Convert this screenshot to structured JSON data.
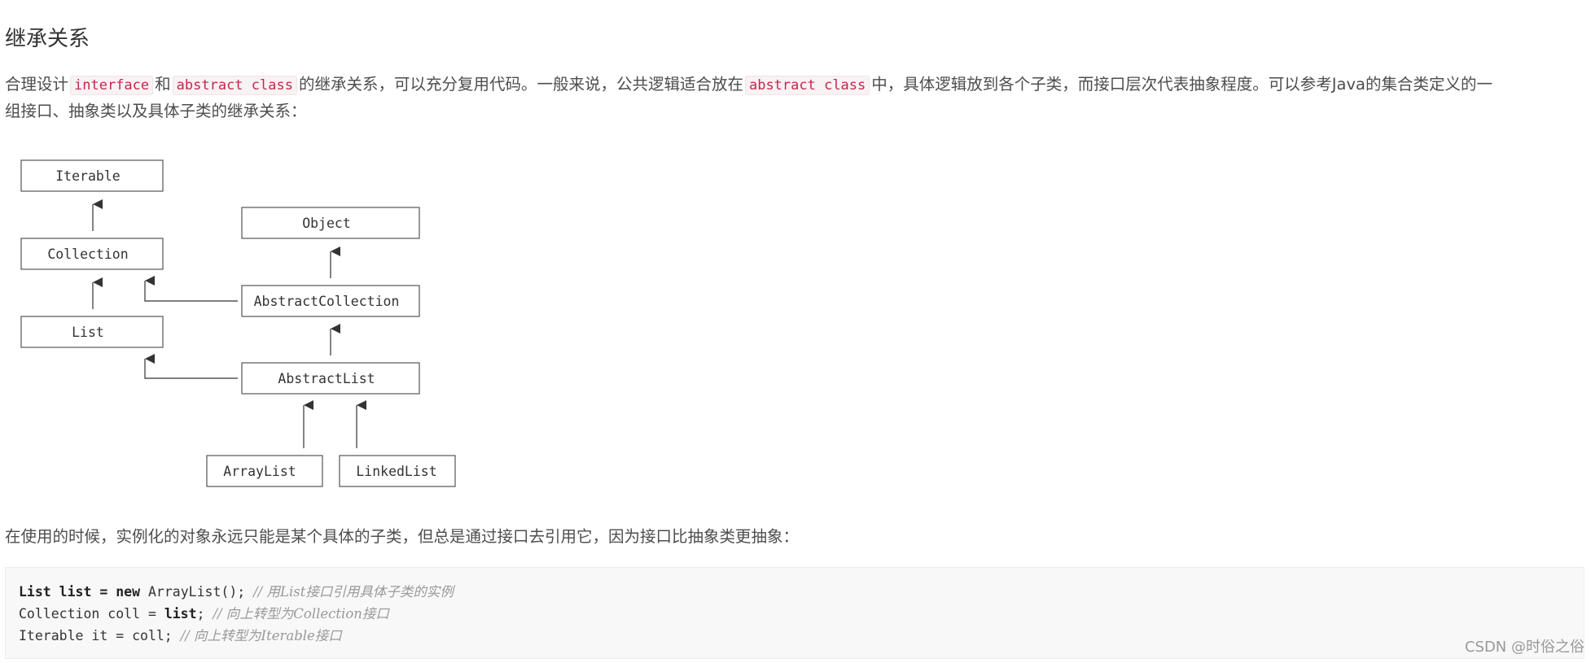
{
  "heading": "继承关系",
  "intro": {
    "part1": "合理设计",
    "code1": "interface",
    "part2": "和",
    "code2": "abstract class",
    "part3": "的继承关系，可以充分复用代码。一般来说，公共逻辑适合放在",
    "code3": "abstract class",
    "part4": "中，具体逻辑放到各个子类，而接口层次代表抽象程度。可以参考Java的集合类定义的一",
    "part5": "组接口、抽象类以及具体子类的继承关系："
  },
  "diagram": {
    "nodes": {
      "iterable": "Iterable",
      "collection": "Collection",
      "list": "List",
      "object": "Object",
      "abstract_collection": "AbstractCollection",
      "abstract_list": "AbstractList",
      "array_list": "ArrayList",
      "linked_list": "LinkedList"
    }
  },
  "usage_text": "在使用的时候，实例化的对象永远只能是某个具体的子类，但总是通过接口去引用它，因为接口比抽象类更抽象：",
  "code": {
    "line1": {
      "kw_type": "List",
      "text_a": " list = ",
      "kw_new": "new",
      "text_b": " ArrayList(); ",
      "comment": "// 用List接口引用具体子类的实例"
    },
    "line2": {
      "text_a": "Collection coll = ",
      "kw_var": "list",
      "text_b": "; ",
      "comment": "// 向上转型为Collection接口"
    },
    "line3": {
      "text_a": "Iterable it = coll; ",
      "comment": "// 向上转型为Iterable接口"
    }
  },
  "watermark": "CSDN @时俗之俗",
  "colors": {
    "inline_code": "#c7254e",
    "inline_code_bg": "#f9f2f4",
    "code_bg": "#f8f8f8",
    "comment": "#999999",
    "text": "#4d4d4d"
  }
}
